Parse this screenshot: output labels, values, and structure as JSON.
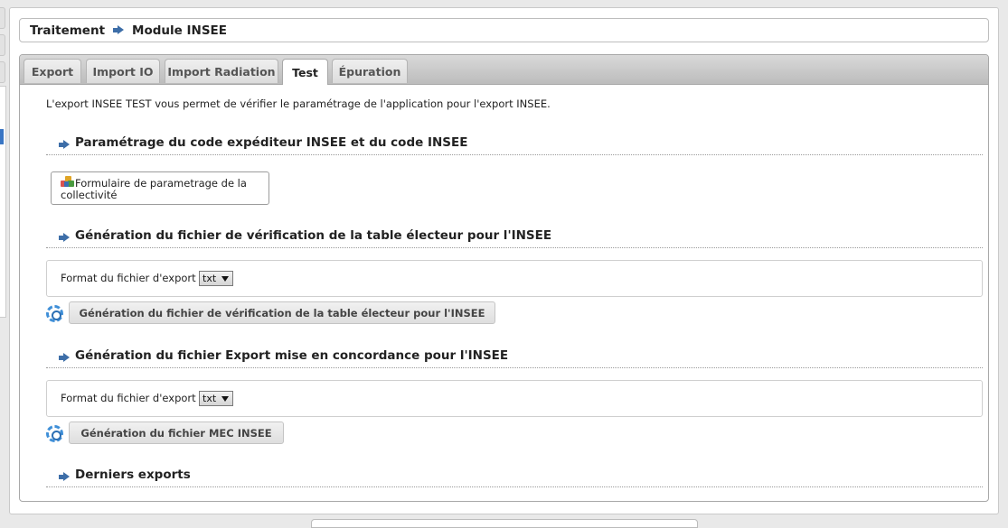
{
  "breadcrumb": {
    "parent": "Traitement",
    "current": "Module INSEE"
  },
  "tabs": [
    {
      "label": "Export",
      "active": false
    },
    {
      "label": "Import IO",
      "active": false
    },
    {
      "label": "Import Radiation",
      "active": false
    },
    {
      "label": "Test",
      "active": true
    },
    {
      "label": "Épuration",
      "active": false
    }
  ],
  "intro": "L'export INSEE TEST vous permet de vérifier le paramétrage de l'application pour l'export INSEE.",
  "section1": {
    "title": "Paramétrage du code expéditeur INSEE et du code INSEE",
    "button_label": "Formulaire de parametrage de la collectivité",
    "button_icon": "cubes-icon"
  },
  "section2": {
    "title": "Génération du fichier de vérification de la table électeur pour l'INSEE",
    "field_label": "Format du fichier d'export",
    "select_value": "txt",
    "button_label": "Génération du fichier de vérification de la table électeur pour l'INSEE",
    "button_icon": "gear-icon"
  },
  "section3": {
    "title": "Génération du fichier Export mise en concordance pour l'INSEE",
    "field_label": "Format du fichier d'export",
    "select_value": "txt",
    "button_label": "Génération du fichier MEC INSEE",
    "button_icon": "gear-icon"
  },
  "section4": {
    "title": "Derniers exports"
  },
  "colors": {
    "accent": "#3d6ea8",
    "gear": "#3f8fd8",
    "active_nav": "#3a76c4"
  }
}
